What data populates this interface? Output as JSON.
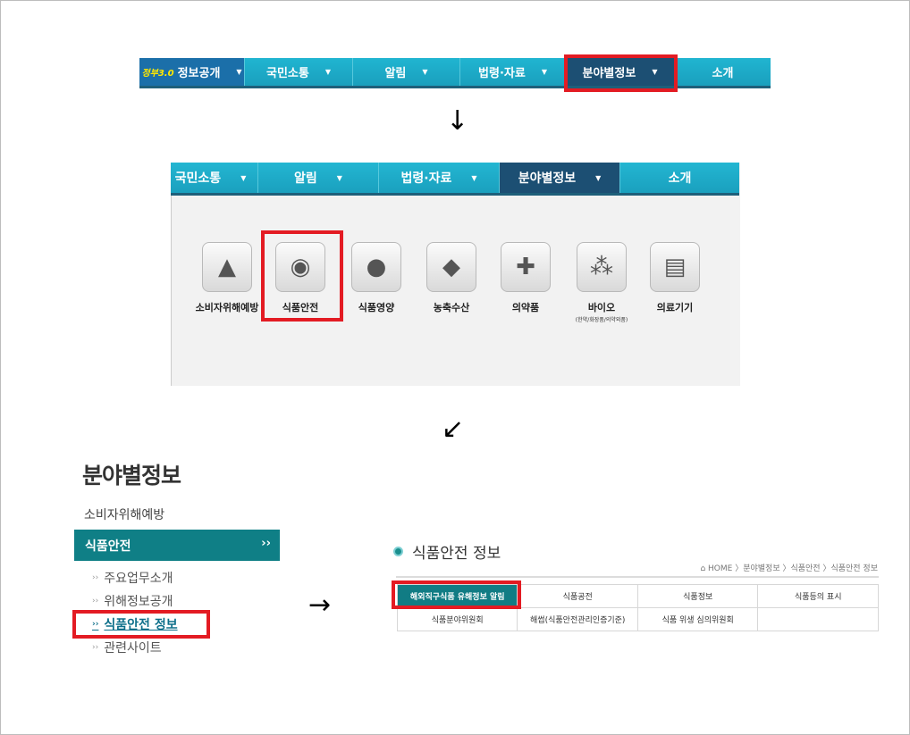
{
  "nav_top": {
    "gov_logo": "정부3.0",
    "items": [
      {
        "label": "정보공개"
      },
      {
        "label": "국민소통"
      },
      {
        "label": "알림"
      },
      {
        "label": "법령·자료"
      },
      {
        "label": "분야별정보"
      },
      {
        "label": "소개"
      }
    ]
  },
  "nav_panel": {
    "items": [
      {
        "label": "국민소통"
      },
      {
        "label": "알림"
      },
      {
        "label": "법령·자료"
      },
      {
        "label": "분야별정보"
      },
      {
        "label": "소개"
      }
    ],
    "categories": [
      {
        "label": "소비자위해예방",
        "icon": "cone-icon"
      },
      {
        "label": "식품안전",
        "icon": "safety-device-icon"
      },
      {
        "label": "식품영양",
        "icon": "fruit-icon"
      },
      {
        "label": "농축수산",
        "icon": "fish-icon"
      },
      {
        "label": "의약품",
        "icon": "mortar-icon"
      },
      {
        "label": "바이오",
        "sub": "(한약/화장품/의약외품)",
        "icon": "dna-icon"
      },
      {
        "label": "의료기기",
        "icon": "monitor-icon"
      }
    ]
  },
  "sidebar": {
    "title": "분야별정보",
    "item0": "소비자위해예방",
    "active": "식품안전",
    "active_marker": "››",
    "sub_marker": "››",
    "subitems": [
      {
        "label": "주요업무소개"
      },
      {
        "label": "위해정보공개"
      },
      {
        "label": "식품안전 정보"
      },
      {
        "label": "관련사이트"
      }
    ]
  },
  "content": {
    "title": "식품안전 정보",
    "breadcrumb": "⌂ HOME 〉분야별정보 〉식품안전 〉식품안전 정보",
    "table": [
      [
        "해외직구식품 유해정보 알림",
        "식품공전",
        "식품정보",
        "식품등의 표시"
      ],
      [
        "식품분야위원회",
        "해썹(식품안전관리인증기준)",
        "식품 위생 심의위원회",
        ""
      ]
    ]
  },
  "arrows": {
    "down": "↓",
    "diag": "↙",
    "right": "→"
  },
  "colors": {
    "nav": "#1aa0be",
    "nav_active": "#1c4f73",
    "highlight": "#e31b23",
    "sidebar_active": "#0f7f86"
  }
}
